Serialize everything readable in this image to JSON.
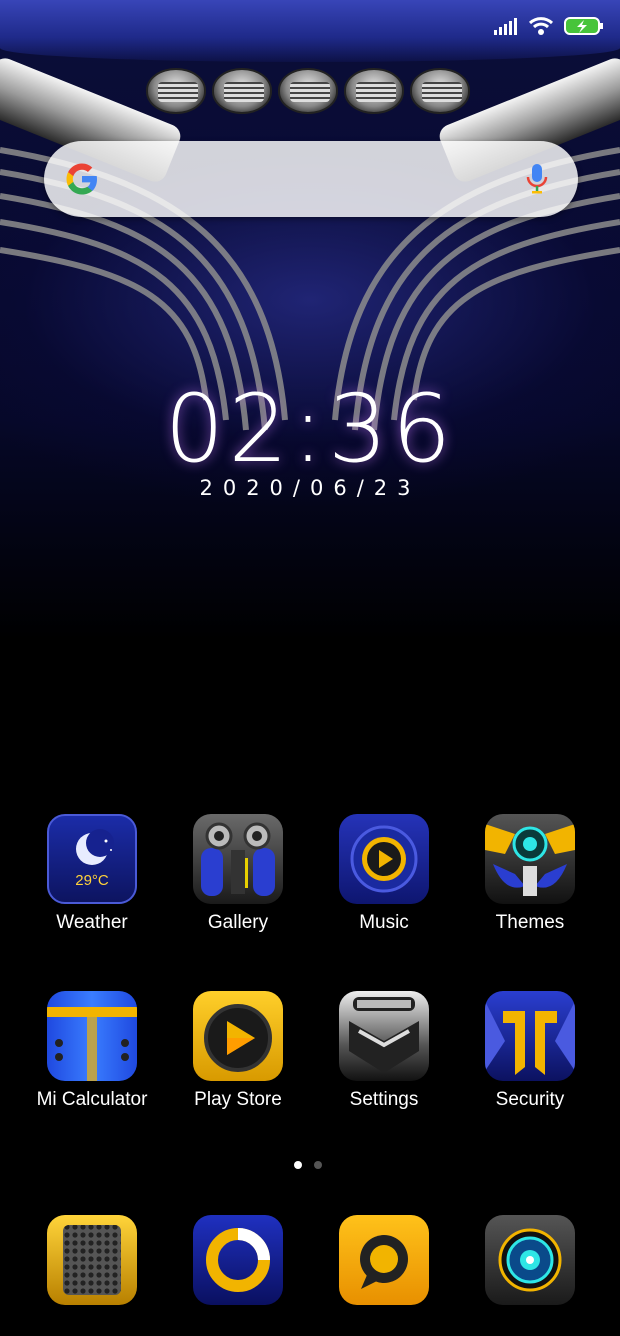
{
  "status_bar": {
    "signal": "signal-icon",
    "wifi": "wifi-icon",
    "battery": "battery-charging-icon"
  },
  "search": {
    "logo": "google-g-icon",
    "mic": "mic-icon"
  },
  "clock": {
    "time": "02:36",
    "date": "2020/06/23"
  },
  "weather_widget": {
    "temp": "29°C"
  },
  "apps_row1": [
    {
      "label": "Weather"
    },
    {
      "label": "Gallery"
    },
    {
      "label": "Music"
    },
    {
      "label": "Themes"
    }
  ],
  "apps_row2": [
    {
      "label": "Mi Calculator"
    },
    {
      "label": "Play Store"
    },
    {
      "label": "Settings"
    },
    {
      "label": "Security"
    }
  ],
  "page_indicator": {
    "current": 1,
    "total": 2
  },
  "dock": [
    {
      "icon": "hexagon-grid-icon"
    },
    {
      "icon": "browser-ring-icon"
    },
    {
      "icon": "message-bubble-icon"
    },
    {
      "icon": "camera-turbine-icon"
    }
  ],
  "colors": {
    "accent_blue": "#2a36b0",
    "accent_gold": "#f2b400"
  }
}
